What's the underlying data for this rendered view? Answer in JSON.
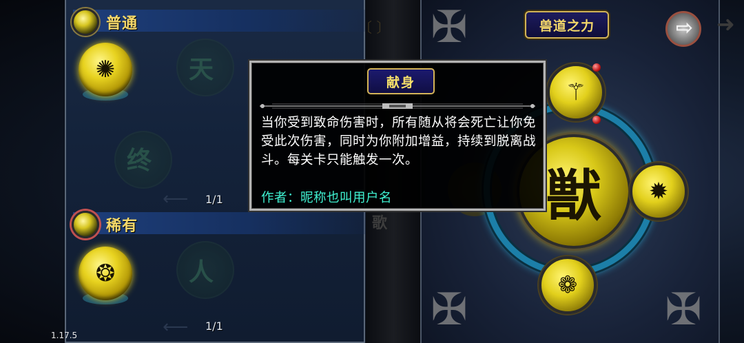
{
  "sections": [
    {
      "title": "普通",
      "pager": "1/1"
    },
    {
      "title": "稀有",
      "pager": "1/1"
    }
  ],
  "panel_title": "兽道之力",
  "tooltip": {
    "title": "献身",
    "description": "当你受到致命伤害时，所有随从将会死亡让你免受此次伤害，同时为你附加增益，持续到脱离战斗。每关卡只能触发一次。",
    "author": "作者：昵称也叫用户名"
  },
  "version": "1.17.5",
  "colors": {
    "gold": "#f4d86a",
    "author_cyan": "#3ff0d0",
    "ring_blue": "#1c7fa8"
  }
}
